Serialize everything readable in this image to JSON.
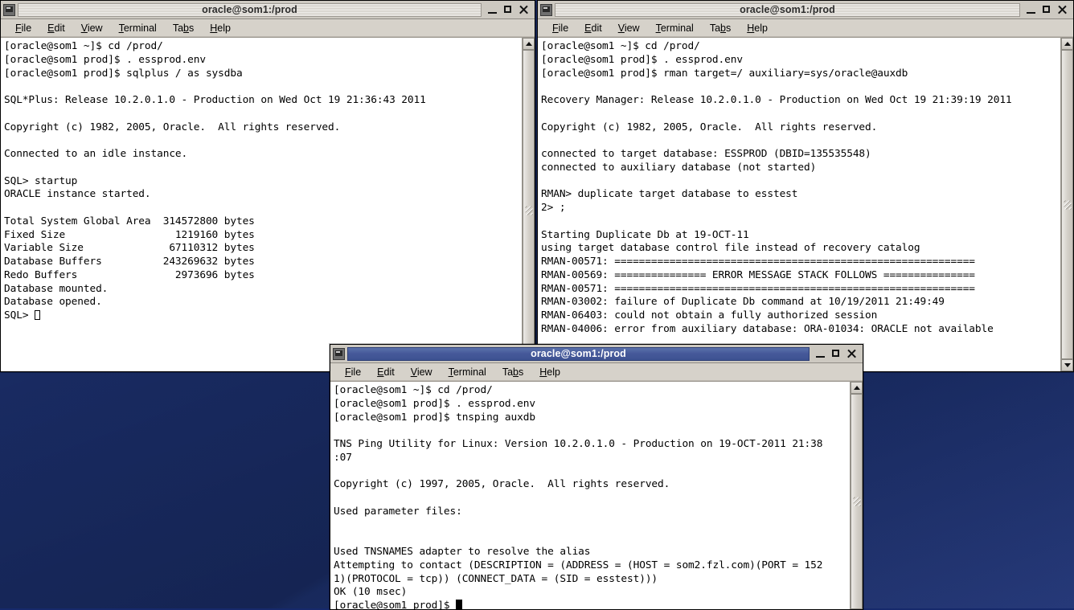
{
  "desktop": {
    "background_color": "#1b2f6e"
  },
  "menu": {
    "items": [
      {
        "label": "File",
        "mnemonic": "F"
      },
      {
        "label": "Edit",
        "mnemonic": "E"
      },
      {
        "label": "View",
        "mnemonic": "V"
      },
      {
        "label": "Terminal",
        "mnemonic": "T"
      },
      {
        "label": "Tabs",
        "mnemonic": "b"
      },
      {
        "label": "Help",
        "mnemonic": "H"
      }
    ]
  },
  "windows": {
    "left": {
      "title": "oracle@som1:/prod",
      "state": "inactive",
      "titlebar_color": "#cdc9c1",
      "content": "[oracle@som1 ~]$ cd /prod/\n[oracle@som1 prod]$ . essprod.env\n[oracle@som1 prod]$ sqlplus / as sysdba\n\nSQL*Plus: Release 10.2.0.1.0 - Production on Wed Oct 19 21:36:43 2011\n\nCopyright (c) 1982, 2005, Oracle.  All rights reserved.\n\nConnected to an idle instance.\n\nSQL> startup\nORACLE instance started.\n\nTotal System Global Area  314572800 bytes\nFixed Size                  1219160 bytes\nVariable Size              67110312 bytes\nDatabase Buffers          243269632 bytes\nRedo Buffers                2973696 bytes\nDatabase mounted.\nDatabase opened.\nSQL> ",
      "cursor": "hollow"
    },
    "right": {
      "title": "oracle@som1:/prod",
      "state": "inactive",
      "titlebar_color": "#cdc9c1",
      "content": "[oracle@som1 ~]$ cd /prod/\n[oracle@som1 prod]$ . essprod.env\n[oracle@som1 prod]$ rman target=/ auxiliary=sys/oracle@auxdb\n\nRecovery Manager: Release 10.2.0.1.0 - Production on Wed Oct 19 21:39:19 2011\n\nCopyright (c) 1982, 2005, Oracle.  All rights reserved.\n\nconnected to target database: ESSPROD (DBID=135535548)\nconnected to auxiliary database (not started)\n\nRMAN> duplicate target database to esstest\n2> ;\n\nStarting Duplicate Db at 19-OCT-11\nusing target database control file instead of recovery catalog\nRMAN-00571: ===========================================================\nRMAN-00569: =============== ERROR MESSAGE STACK FOLLOWS ===============\nRMAN-00571: ===========================================================\nRMAN-03002: failure of Duplicate Db command at 10/19/2011 21:49:49\nRMAN-06403: could not obtain a fully authorized session\nRMAN-04006: error from auxiliary database: ORA-01034: ORACLE not available",
      "cursor": "none"
    },
    "bottom": {
      "title": "oracle@som1:/prod",
      "state": "active",
      "titlebar_color": "#46599a",
      "content": "[oracle@som1 ~]$ cd /prod/\n[oracle@som1 prod]$ . essprod.env\n[oracle@som1 prod]$ tnsping auxdb\n\nTNS Ping Utility for Linux: Version 10.2.0.1.0 - Production on 19-OCT-2011 21:38\n:07\n\nCopyright (c) 1997, 2005, Oracle.  All rights reserved.\n\nUsed parameter files:\n\n\nUsed TNSNAMES adapter to resolve the alias\nAttempting to contact (DESCRIPTION = (ADDRESS = (HOST = som2.fzl.com)(PORT = 152\n1)(PROTOCOL = tcp)) (CONNECT_DATA = (SID = esstest)))\nOK (10 msec)\n[oracle@som1 prod]$ ",
      "cursor": "block"
    }
  },
  "window_buttons": {
    "minimize": "minimize-button",
    "maximize": "maximize-button",
    "close": "close-button"
  }
}
